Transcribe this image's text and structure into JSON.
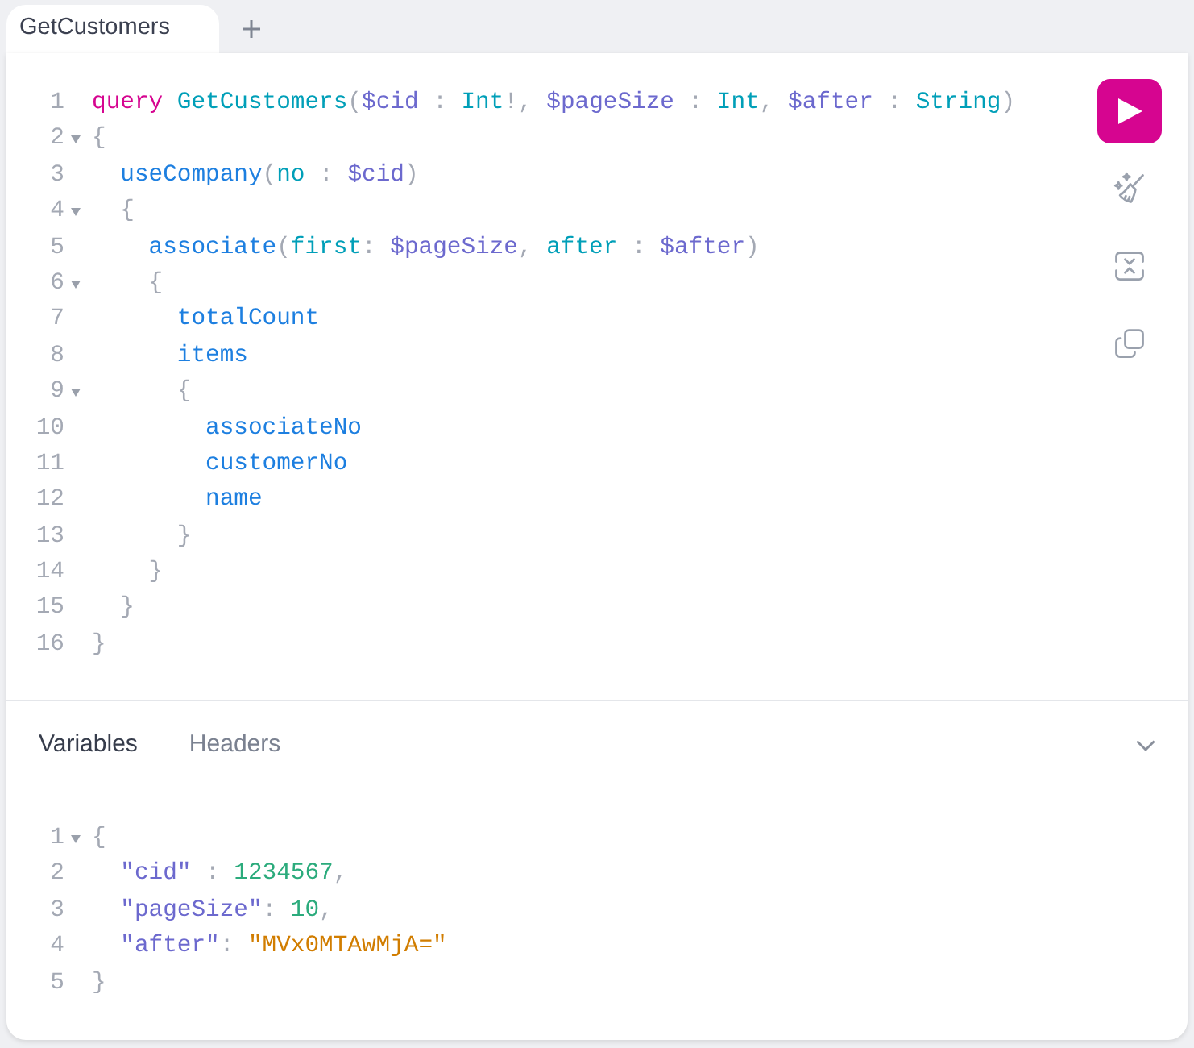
{
  "tabs": [
    {
      "label": "GetCustomers",
      "selected": true
    }
  ],
  "query_editor": {
    "lines": [
      {
        "number": "1",
        "foldable": false,
        "tokens": [
          {
            "kind": "keyword",
            "text": "query "
          },
          {
            "kind": "def",
            "text": "GetCustomers"
          },
          {
            "kind": "punct",
            "text": "("
          },
          {
            "kind": "variable",
            "text": "$cid"
          },
          {
            "kind": "punct",
            "text": " : "
          },
          {
            "kind": "type",
            "text": "Int"
          },
          {
            "kind": "punct",
            "text": "!, "
          },
          {
            "kind": "variable",
            "text": "$pageSize"
          },
          {
            "kind": "punct",
            "text": " : "
          },
          {
            "kind": "type",
            "text": "Int"
          },
          {
            "kind": "punct",
            "text": ", "
          },
          {
            "kind": "variable",
            "text": "$after"
          },
          {
            "kind": "punct",
            "text": " : "
          },
          {
            "kind": "type",
            "text": "String"
          },
          {
            "kind": "punct",
            "text": ")"
          }
        ]
      },
      {
        "number": "2",
        "foldable": true,
        "tokens": [
          {
            "kind": "punct",
            "text": "{"
          }
        ],
        "children": [
          {
            "number": "3",
            "foldable": false,
            "tokens": [
              {
                "kind": "field",
                "text": "useCompany"
              },
              {
                "kind": "punct",
                "text": "("
              },
              {
                "kind": "attribute",
                "text": "no"
              },
              {
                "kind": "punct",
                "text": " : "
              },
              {
                "kind": "variable",
                "text": "$cid"
              },
              {
                "kind": "punct",
                "text": ")"
              }
            ]
          },
          {
            "number": "4",
            "foldable": true,
            "tokens": [
              {
                "kind": "punct",
                "text": "{"
              }
            ],
            "children": [
              {
                "number": "5",
                "foldable": false,
                "tokens": [
                  {
                    "kind": "field",
                    "text": "associate"
                  },
                  {
                    "kind": "punct",
                    "text": "("
                  },
                  {
                    "kind": "attribute",
                    "text": "first"
                  },
                  {
                    "kind": "punct",
                    "text": ": "
                  },
                  {
                    "kind": "variable",
                    "text": "$pageSize"
                  },
                  {
                    "kind": "punct",
                    "text": ", "
                  },
                  {
                    "kind": "attribute",
                    "text": "after"
                  },
                  {
                    "kind": "punct",
                    "text": " : "
                  },
                  {
                    "kind": "variable",
                    "text": "$after"
                  },
                  {
                    "kind": "punct",
                    "text": ")"
                  }
                ]
              },
              {
                "number": "6",
                "foldable": true,
                "tokens": [
                  {
                    "kind": "punct",
                    "text": "{"
                  }
                ],
                "children": [
                  {
                    "number": "7",
                    "foldable": false,
                    "tokens": [
                      {
                        "kind": "field",
                        "text": "totalCount"
                      }
                    ]
                  },
                  {
                    "number": "8",
                    "foldable": false,
                    "tokens": [
                      {
                        "kind": "field",
                        "text": "items"
                      }
                    ]
                  },
                  {
                    "number": "9",
                    "foldable": true,
                    "tokens": [
                      {
                        "kind": "punct",
                        "text": "{"
                      }
                    ],
                    "children": [
                      {
                        "number": "10",
                        "foldable": false,
                        "tokens": [
                          {
                            "kind": "field",
                            "text": "associateNo"
                          }
                        ]
                      },
                      {
                        "number": "11",
                        "foldable": false,
                        "tokens": [
                          {
                            "kind": "field",
                            "text": "customerNo"
                          }
                        ]
                      },
                      {
                        "number": "12",
                        "foldable": false,
                        "tokens": [
                          {
                            "kind": "field",
                            "text": "name"
                          }
                        ]
                      }
                    ]
                  },
                  {
                    "number": "13",
                    "foldable": false,
                    "tokens": [
                      {
                        "kind": "punct",
                        "text": "}"
                      }
                    ]
                  }
                ]
              },
              {
                "number": "14",
                "foldable": false,
                "tokens": [
                  {
                    "kind": "punct",
                    "text": "}"
                  }
                ]
              }
            ]
          },
          {
            "number": "15",
            "foldable": false,
            "tokens": [
              {
                "kind": "punct",
                "text": "}"
              }
            ]
          }
        ]
      },
      {
        "number": "16",
        "foldable": false,
        "tokens": [
          {
            "kind": "punct",
            "text": "}"
          }
        ]
      }
    ]
  },
  "variables_panel": {
    "tabs": [
      {
        "label": "Variables",
        "selected": true
      },
      {
        "label": "Headers",
        "selected": false
      }
    ],
    "lines": [
      {
        "number": "1",
        "foldable": true,
        "tokens": [
          {
            "kind": "punct",
            "text": "{"
          }
        ],
        "children": [
          {
            "number": "2",
            "foldable": false,
            "tokens": [
              {
                "kind": "variable",
                "text": "\"cid\""
              },
              {
                "kind": "punct",
                "text": " : "
              },
              {
                "kind": "number",
                "text": "1234567"
              },
              {
                "kind": "punct",
                "text": ","
              }
            ]
          },
          {
            "number": "3",
            "foldable": false,
            "tokens": [
              {
                "kind": "variable",
                "text": "\"pageSize\""
              },
              {
                "kind": "punct",
                "text": ": "
              },
              {
                "kind": "number",
                "text": "10"
              },
              {
                "kind": "punct",
                "text": ","
              }
            ]
          },
          {
            "number": "4",
            "foldable": false,
            "tokens": [
              {
                "kind": "variable",
                "text": "\"after\""
              },
              {
                "kind": "punct",
                "text": ": "
              },
              {
                "kind": "string",
                "text": "\"MVx0MTAwMjA=\""
              }
            ]
          }
        ]
      },
      {
        "number": "5",
        "foldable": false,
        "tokens": [
          {
            "kind": "punct",
            "text": "}"
          }
        ]
      }
    ]
  }
}
